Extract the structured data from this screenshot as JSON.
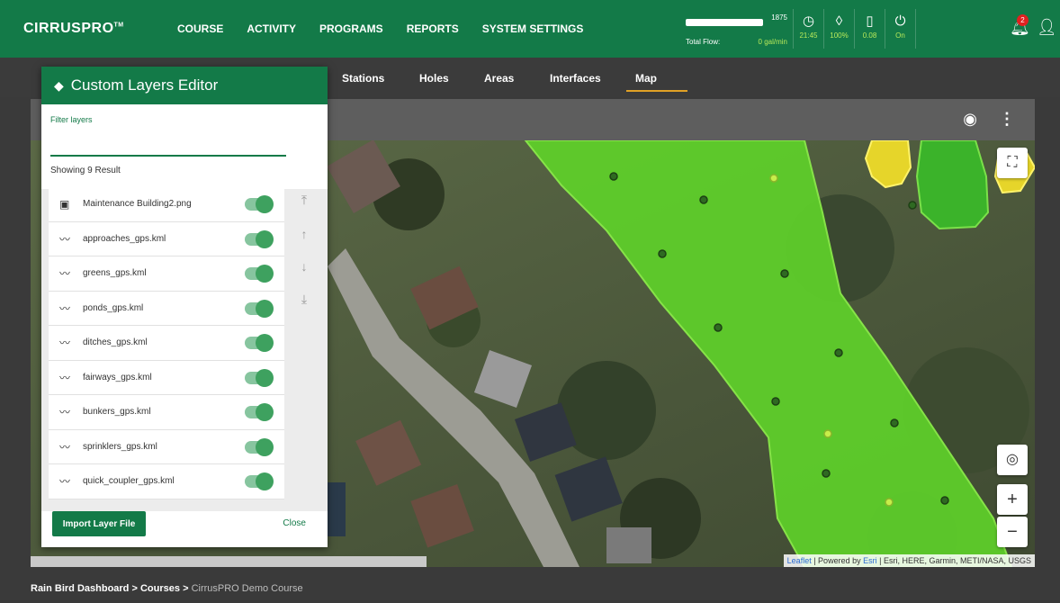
{
  "header": {
    "logo_a": "CIRRUS",
    "logo_b": "PRO",
    "logo_tm": "TM",
    "nav": [
      "COURSE",
      "ACTIVITY",
      "PROGRAMS",
      "REPORTS",
      "SYSTEM SETTINGS"
    ],
    "flow_value": "1875",
    "flow_label": "Total Flow:",
    "flow_rate": "0 gal/min",
    "stats": [
      {
        "icon": "clock-icon",
        "glyph": "◷",
        "value": "21:45"
      },
      {
        "icon": "water-drop-icon",
        "glyph": "◊",
        "value": "100%"
      },
      {
        "icon": "rain-gauge-icon",
        "glyph": "▯",
        "value": "0.08"
      },
      {
        "icon": "power-icon",
        "glyph": "⏻",
        "value": "On"
      }
    ],
    "notification_count": "2"
  },
  "tabs": [
    "Stations",
    "Holes",
    "Areas",
    "Interfaces",
    "Map"
  ],
  "active_tab": "Map",
  "panel": {
    "title": "Custom Layers Editor",
    "filter_label": "Filter layers",
    "filter_value": "",
    "showing": "Showing 9 Result",
    "layers": [
      {
        "name": "Maintenance Building2.png",
        "icon": "image-icon",
        "enabled": true
      },
      {
        "name": "approaches_gps.kml",
        "icon": "polyline-icon",
        "enabled": true
      },
      {
        "name": "greens_gps.kml",
        "icon": "polyline-icon",
        "enabled": true
      },
      {
        "name": "ponds_gps.kml",
        "icon": "polyline-icon",
        "enabled": true
      },
      {
        "name": "ditches_gps.kml",
        "icon": "polyline-icon",
        "enabled": true
      },
      {
        "name": "fairways_gps.kml",
        "icon": "polyline-icon",
        "enabled": true
      },
      {
        "name": "bunkers_gps.kml",
        "icon": "polyline-icon",
        "enabled": true
      },
      {
        "name": "sprinklers_gps.kml",
        "icon": "polyline-icon",
        "enabled": true
      },
      {
        "name": "quick_coupler_gps.kml",
        "icon": "polyline-icon",
        "enabled": true
      }
    ],
    "import_label": "Import Layer File",
    "close_label": "Close"
  },
  "map": {
    "attribution_leaflet": "Leaflet",
    "attribution_rest": "| Powered by",
    "attribution_esri": "Esri",
    "attribution_tail": "| Esri, HERE, Garmin, METI/NASA, USGS"
  },
  "breadcrumb": {
    "a": "Rain Bird Dashboard",
    "sep": ">",
    "b": "Courses",
    "c": "CirrusPRO Demo Course"
  },
  "colors": {
    "brand": "#137a48",
    "accent": "#e1a125",
    "fairway": "#5fd12a",
    "bunker": "#e6d52a"
  }
}
